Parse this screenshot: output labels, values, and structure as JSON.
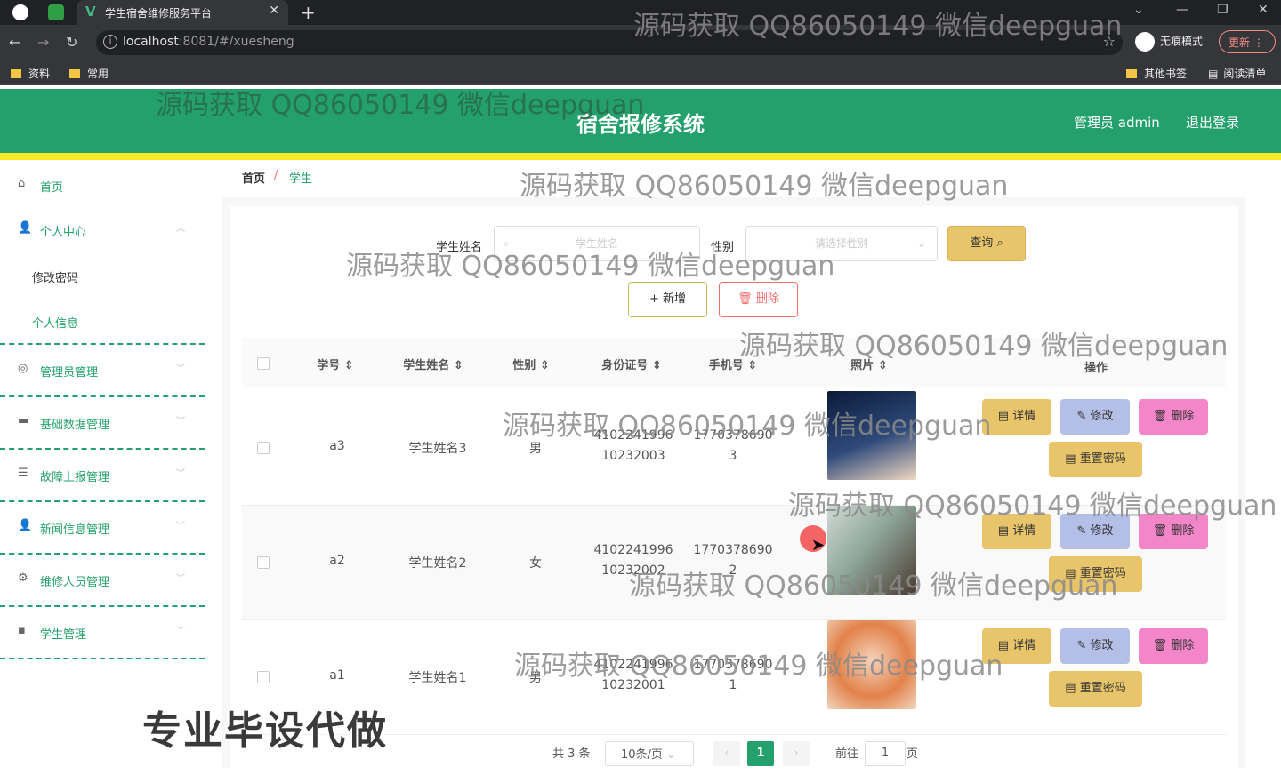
{
  "browser": {
    "tab_title": "学生宿舍维修服务平台",
    "tab_close": "✕",
    "new_tab": "+",
    "url_host": "localhost",
    "url_rest": ":8081/#/xuesheng",
    "incognito_label": "无痕模式",
    "update_label": "更新",
    "bookmarks": [
      "资料",
      "常用"
    ],
    "other_bookmarks": "其他书签",
    "reading_list": "阅读清单"
  },
  "header": {
    "title": "宿舍报修系统",
    "admin": "管理员 admin",
    "logout": "退出登录"
  },
  "sidebar": {
    "home": "首页",
    "personal_center": "个人中心",
    "change_password": "修改密码",
    "personal_info": "个人信息",
    "admin_mgmt": "管理员管理",
    "base_data_mgmt": "基础数据管理",
    "fault_report_mgmt": "故障上报管理",
    "news_mgmt": "新闻信息管理",
    "repairman_mgmt": "维修人员管理",
    "student_mgmt": "学生管理"
  },
  "breadcrumb": {
    "home": "首页",
    "sep": "/",
    "current": "学生"
  },
  "search": {
    "name_label": "学生姓名",
    "name_placeholder": "学生姓名",
    "gender_label": "性别",
    "gender_placeholder": "请选择性别",
    "query_btn": "查询"
  },
  "actions": {
    "add": "新增",
    "delete": "删除"
  },
  "table": {
    "headers": [
      "学号",
      "学生姓名",
      "性别",
      "身份证号",
      "手机号",
      "照片",
      "操作"
    ],
    "rows": [
      {
        "id": "a3",
        "name": "学生姓名3",
        "gender": "男",
        "idcard1": "4102241996",
        "idcard2": "10232003",
        "phone1": "1770378690",
        "phone2": "3"
      },
      {
        "id": "a2",
        "name": "学生姓名2",
        "gender": "女",
        "idcard1": "4102241996",
        "idcard2": "10232002",
        "phone1": "1770378690",
        "phone2": "2"
      },
      {
        "id": "a1",
        "name": "学生姓名1",
        "gender": "男",
        "idcard1": "4102241996",
        "idcard2": "10232001",
        "phone1": "1770378690",
        "phone2": "1"
      }
    ],
    "btn_detail": "详情",
    "btn_edit": "修改",
    "btn_delete": "删除",
    "btn_reset": "重置密码"
  },
  "pagination": {
    "total": "共 3 条",
    "page_size": "10条/页",
    "current": "1",
    "goto": "前往",
    "goto_value": "1",
    "page_suffix": "页"
  },
  "watermark": "源码获取 QQ86050149 微信deepguan",
  "promo": "专业毕设代做"
}
